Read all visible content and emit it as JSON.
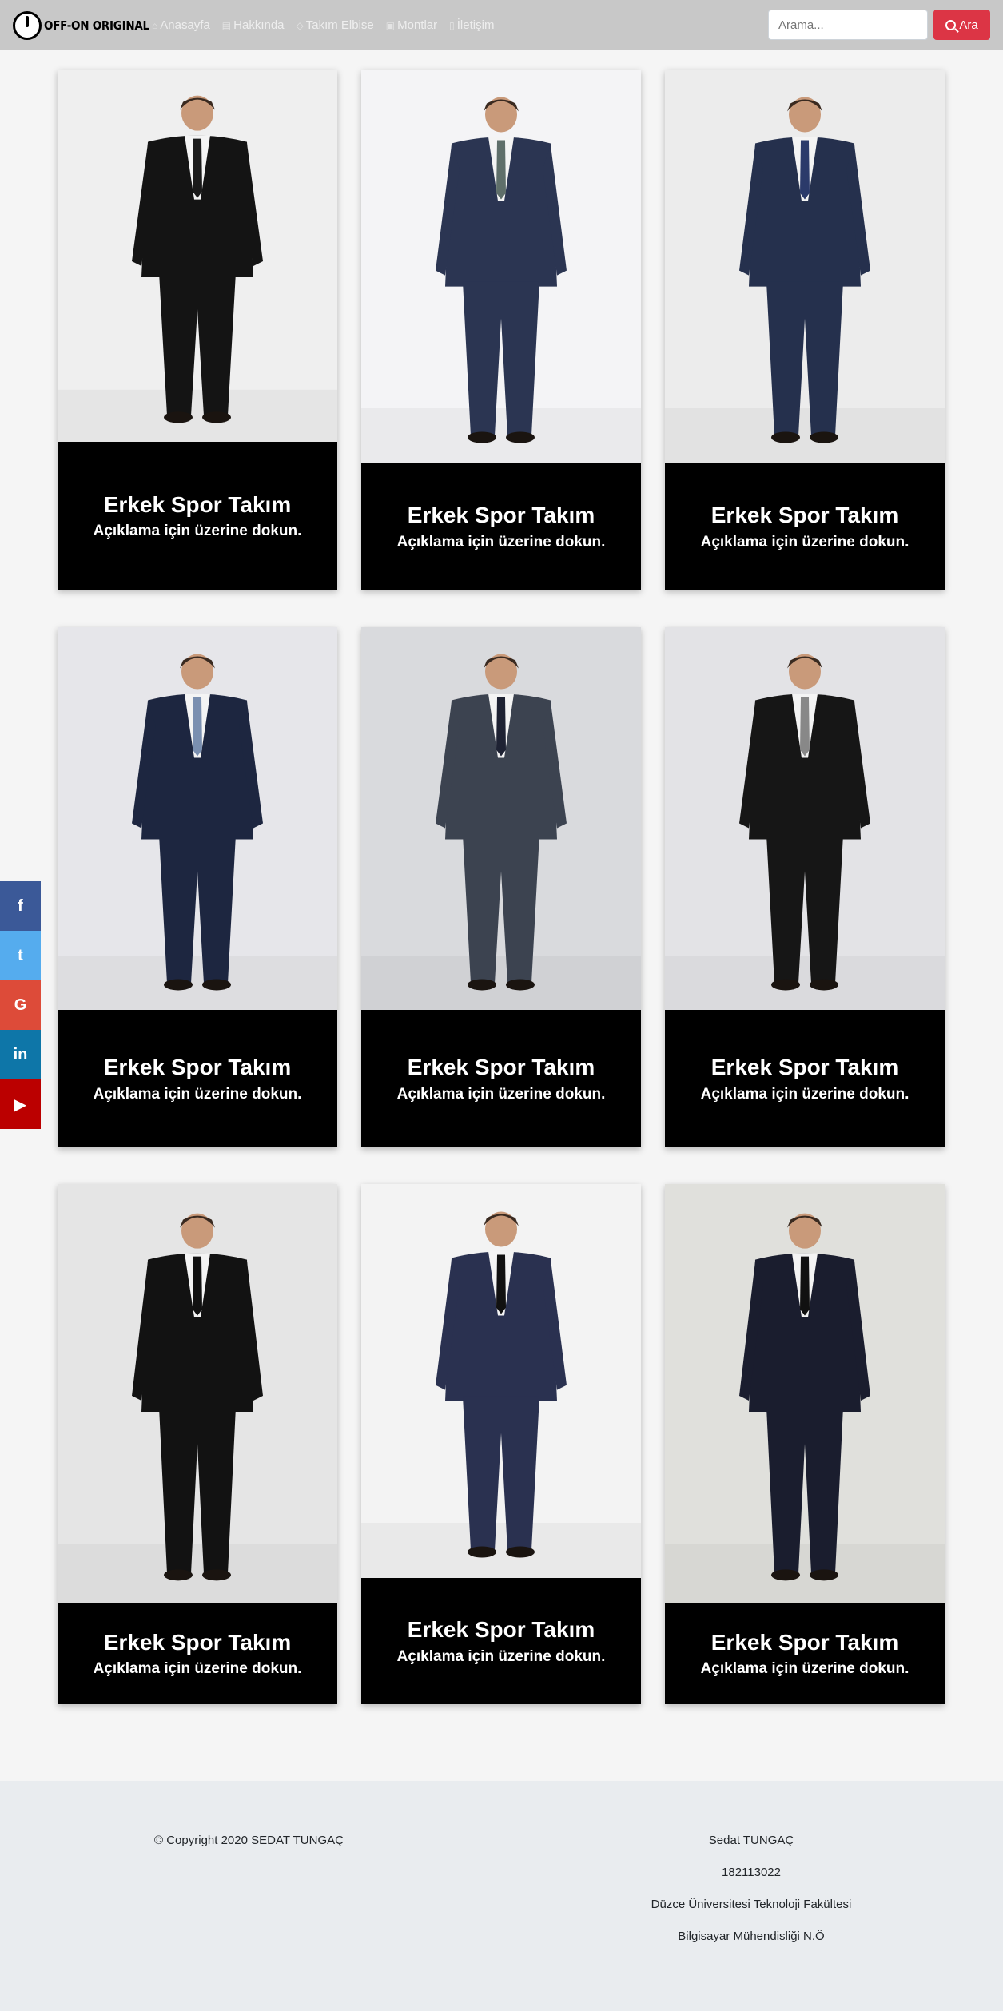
{
  "brand": {
    "name": "OFF-ON ORIGINAL"
  },
  "nav": [
    {
      "label": "Anasayfa",
      "icon": "home-icon"
    },
    {
      "label": "Hakkında",
      "icon": "info-card-icon"
    },
    {
      "label": "Takım Elbise",
      "icon": "gem-icon"
    },
    {
      "label": "Montlar",
      "icon": "images-icon"
    },
    {
      "label": "İletişim",
      "icon": "phone-icon"
    }
  ],
  "search": {
    "placeholder": "Arama...",
    "button_label": "Ara"
  },
  "cards": [
    {
      "title": "Erkek Spor Takım",
      "desc": "Açıklama için üzerine dokun.",
      "suit": "#141414",
      "tie": "#1a1a1a",
      "bg": "#efefef"
    },
    {
      "title": "Erkek Spor Takım",
      "desc": "Açıklama için üzerine dokun.",
      "suit": "#2b3552",
      "tie": "#5f6f6a",
      "bg": "#f4f4f6"
    },
    {
      "title": "Erkek Spor Takım",
      "desc": "Açıklama için üzerine dokun.",
      "suit": "#25304d",
      "tie": "#2b3a6a",
      "bg": "#ececec"
    },
    {
      "title": "Erkek Spor Takım",
      "desc": "Açıklama için üzerine dokun.",
      "suit": "#1d2640",
      "tie": "#7a8fb0",
      "bg": "#e6e6ea"
    },
    {
      "title": "Erkek Spor Takım",
      "desc": "Açıklama için üzerine dokun.",
      "suit": "#3c4350",
      "tie": "#1e2233",
      "bg": "#d9dadd"
    },
    {
      "title": "Erkek Spor Takım",
      "desc": "Açıklama için üzerine dokun.",
      "suit": "#161616",
      "tie": "#888888",
      "bg": "#e3e3e6"
    },
    {
      "title": "Erkek Spor Takım",
      "desc": "Açıklama için üzerine dokun.",
      "suit": "#121212",
      "tie": "#111111",
      "bg": "#e5e5e5"
    },
    {
      "title": "Erkek Spor Takım",
      "desc": "Açıklama için üzerine dokun.",
      "suit": "#2a3150",
      "tie": "#111111",
      "bg": "#f3f3f3"
    },
    {
      "title": "Erkek Spor Takım",
      "desc": "Açıklama için üzerine dokun.",
      "suit": "#1a1d2e",
      "tie": "#111111",
      "bg": "#e0e0dc"
    }
  ],
  "social": [
    {
      "icon": "facebook-icon",
      "glyph": "f",
      "color": "#3b5998"
    },
    {
      "icon": "twitter-icon",
      "glyph": "t",
      "color": "#55acee"
    },
    {
      "icon": "google-icon",
      "glyph": "G",
      "color": "#dd4b39"
    },
    {
      "icon": "linkedin-icon",
      "glyph": "in",
      "color": "#0e76a8"
    },
    {
      "icon": "youtube-icon",
      "glyph": "▶",
      "color": "#bb0000"
    }
  ],
  "footer": {
    "copyright": "© Copyright 2020 SEDAT TUNGAÇ",
    "name": "Sedat TUNGAÇ",
    "student_no": "182113022",
    "university": "Düzce Üniversitesi Teknoloji Fakültesi",
    "department": "Bilgisayar Mühendisliği N.Ö"
  }
}
